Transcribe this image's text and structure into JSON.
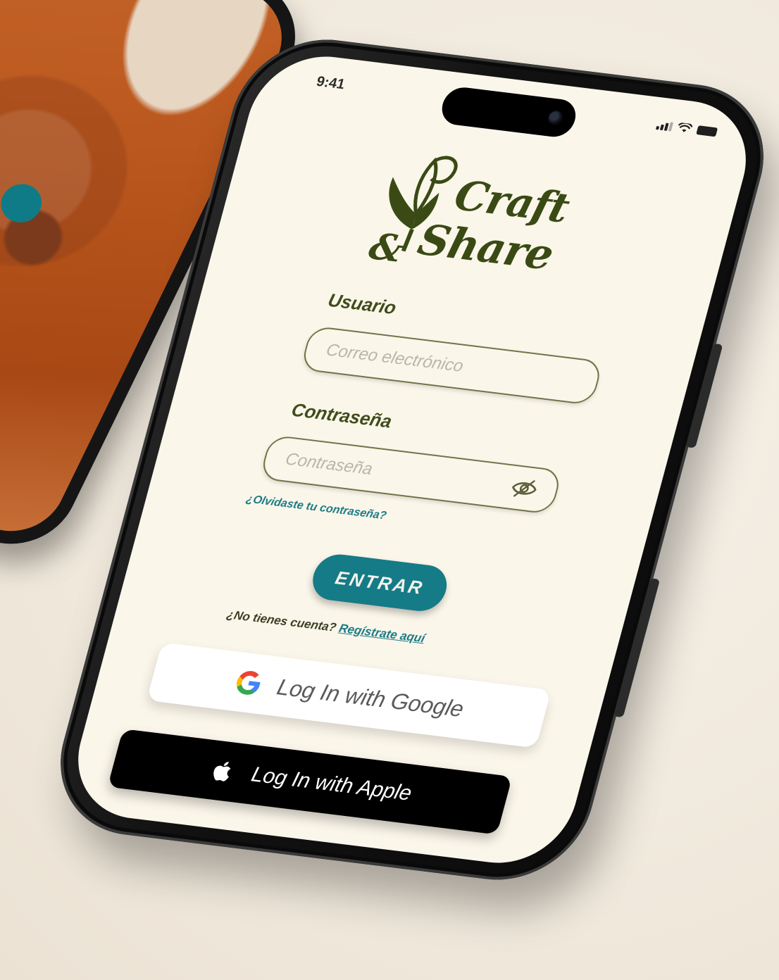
{
  "status_bar": {
    "time": "9:41"
  },
  "logo": {
    "line1": "Craft",
    "line2": "Share"
  },
  "login_form": {
    "user_label": "Usuario",
    "user_placeholder": "Correo electrónico",
    "password_label": "Contraseña",
    "password_placeholder": "Contraseña",
    "forgot_link": "¿Olvidaste tu contraseña?",
    "submit_label": "ENTRAR",
    "no_account_text": "¿No tienes cuenta?",
    "register_link": "Regístrate aquí"
  },
  "social_login": {
    "google_label": "Log In with Google",
    "apple_label": "Log In with Apple"
  },
  "colors": {
    "screen_background": "#fbf6ea",
    "brand_olive": "#3a4a14",
    "accent_teal": "#157b86"
  },
  "icons": [
    "google-icon",
    "apple-icon",
    "eye-slash-icon",
    "signal-icon",
    "wifi-icon",
    "battery-icon"
  ]
}
